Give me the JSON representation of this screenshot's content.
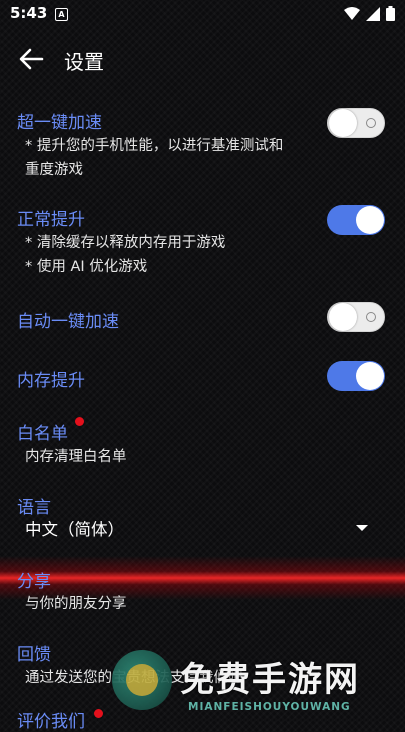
{
  "status_bar": {
    "time": "5:43",
    "notification_glyph": "A"
  },
  "app_bar": {
    "title": "设置"
  },
  "prefs": [
    {
      "title": "超一键加速",
      "summary": [
        "* 提升您的手机性能，以进行基准测试和",
        "重度游戏"
      ],
      "toggle": "off"
    },
    {
      "title": "正常提升",
      "summary": [
        "* 清除缓存以释放内存用于游戏",
        "* 使用 AI 优化游戏"
      ],
      "toggle": "on"
    },
    {
      "title": "自动一键加速",
      "toggle": "off"
    },
    {
      "title": "内存提升",
      "toggle": "on"
    },
    {
      "title": "白名单",
      "summary": [
        "内存清理白名单"
      ],
      "badge": true
    },
    {
      "title": "语言",
      "value": "中文（简体）"
    },
    {
      "title": "分享",
      "summary": [
        "与你的朋友分享"
      ]
    },
    {
      "title": "回馈",
      "summary": [
        "通过发送您的宝贵想法支持我们吧"
      ]
    },
    {
      "title": "评价我们",
      "badge": true
    }
  ],
  "watermark": {
    "cn": "免费手游网",
    "en": "MIANFEISHOUYOUWANG"
  },
  "colors": {
    "accent": "#6a8cf6",
    "toggle_on": "#4e79e8",
    "badge": "#e4101c"
  }
}
